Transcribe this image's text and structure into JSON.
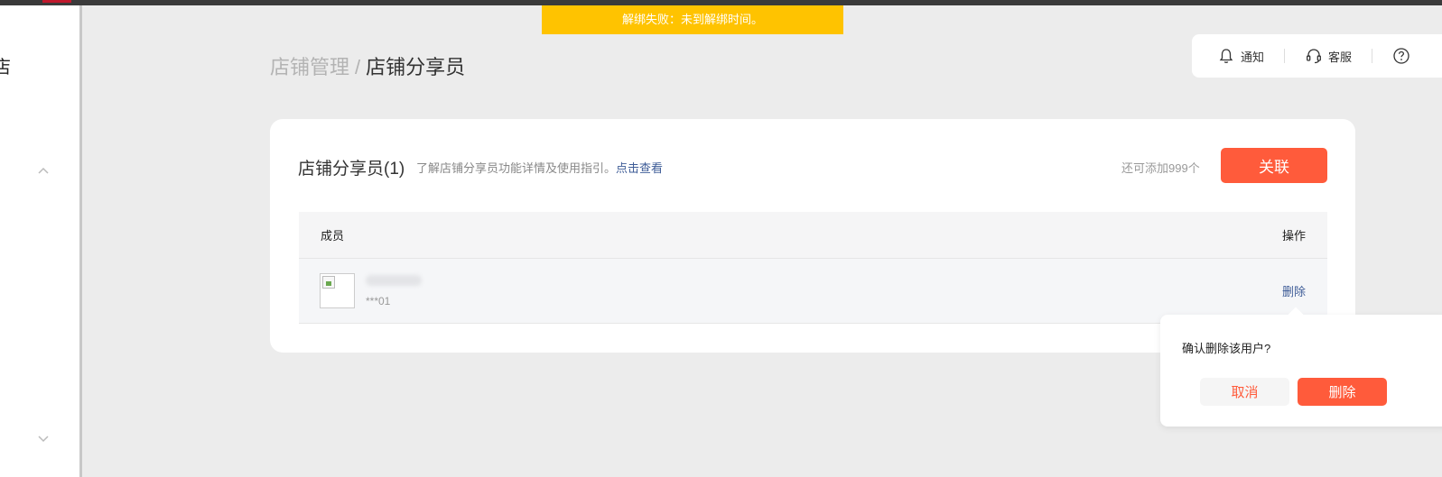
{
  "toast": {
    "message": "解绑失败：未到解绑时间。"
  },
  "sidebar": {
    "partial_text": "店"
  },
  "breadcrumb": {
    "parent": "店铺管理",
    "separator": "/",
    "current": "店铺分享员"
  },
  "toolbar": {
    "notify_label": "通知",
    "service_label": "客服",
    "icons": [
      "bell-icon",
      "headset-icon",
      "help-icon"
    ]
  },
  "card": {
    "title": "店铺分享员(1)",
    "description": "了解店铺分享员功能详情及使用指引。",
    "description_link": "点击查看",
    "remaining": "还可添加999个",
    "associate_button": "关联"
  },
  "table": {
    "headers": {
      "member": "成员",
      "action": "操作"
    },
    "rows": [
      {
        "name": "",
        "id": "***01",
        "action": "删除"
      }
    ]
  },
  "popconfirm": {
    "message": "确认删除该用户?",
    "cancel_label": "取消",
    "confirm_label": "删除"
  },
  "colors": {
    "accent": "#ff5b3b",
    "toast_bg": "#ffc300",
    "link": "#3e5c97"
  }
}
